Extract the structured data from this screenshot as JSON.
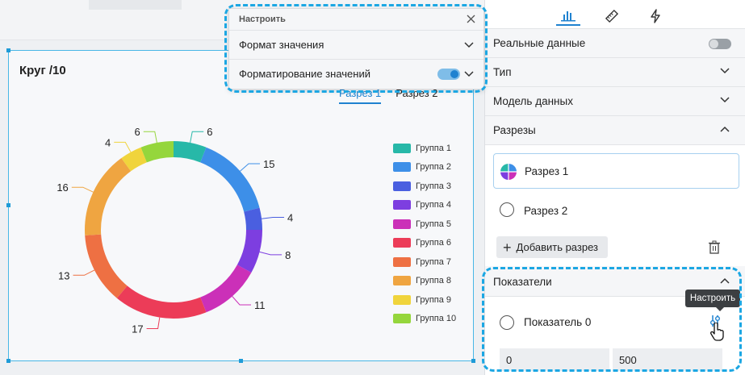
{
  "chart_card": {
    "title": "Круг /10",
    "tabs": [
      {
        "label": "Разрез 1",
        "active": true
      },
      {
        "label": "Разрез 2",
        "active": false
      }
    ]
  },
  "chart_data": {
    "type": "pie",
    "categories": [
      "Группа 1",
      "Группа 2",
      "Группа 3",
      "Группа 4",
      "Группа 5",
      "Группа 6",
      "Группа 7",
      "Группа  8",
      "Группа 9",
      "Группа  10"
    ],
    "values": [
      6,
      15,
      4,
      8,
      11,
      17,
      13,
      16,
      4,
      6
    ],
    "colors": [
      "#27b8a8",
      "#3d8fe8",
      "#4a5fe0",
      "#7d3ee0",
      "#cb30b8",
      "#ec3c58",
      "#ee7043",
      "#efa541",
      "#f0d43c",
      "#95d63c"
    ],
    "donut": true
  },
  "right_panel": {
    "tabs": [
      {
        "icon": "bar-chart-icon",
        "active": true
      },
      {
        "icon": "ruler-icon",
        "active": false
      },
      {
        "icon": "lightning-icon",
        "active": false
      }
    ],
    "real_data_label": "Реальные данные",
    "type_label": "Тип",
    "data_model_label": "Модель данных",
    "cuts_label": "Разрезы",
    "cuts": [
      {
        "label": "Разрез 1",
        "selected": true
      },
      {
        "label": "Разрез 2",
        "selected": false
      }
    ],
    "add_cut_label": "Добавить разрез",
    "measures_label": "Показатели",
    "measure": {
      "label": "Показатель 0",
      "min": "0",
      "max": "500"
    },
    "tooltip": "Настроить"
  },
  "popup": {
    "title": "Настроить",
    "rows": [
      {
        "label": "Формат значения"
      },
      {
        "label": "Форматирование значений",
        "toggle": true
      }
    ]
  }
}
